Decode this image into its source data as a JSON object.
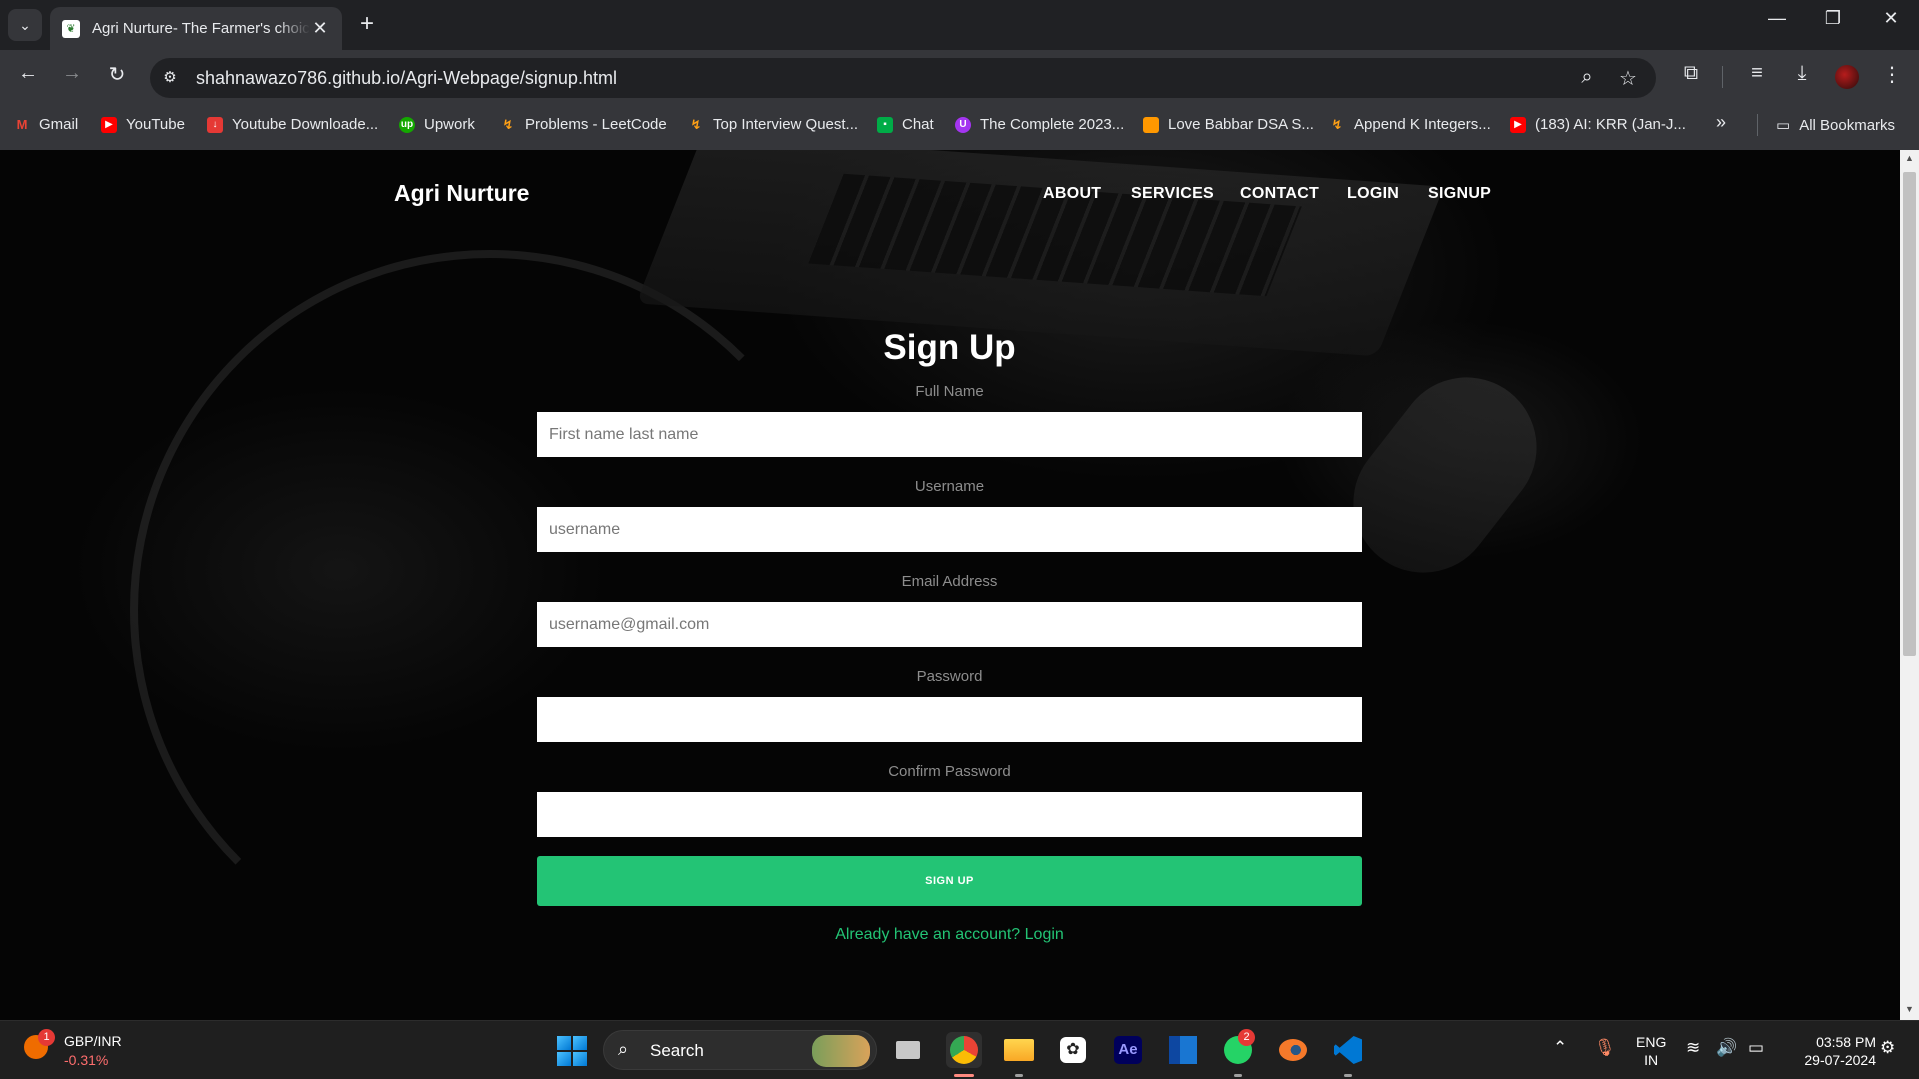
{
  "browser": {
    "tab_title": "Agri Nurture- The Farmer's choice",
    "url": "shahnawazo786.github.io/Agri-Webpage/signup.html",
    "bookmarks": [
      {
        "label": "Gmail",
        "icon": "gmail-icon",
        "color": "#ea4335"
      },
      {
        "label": "YouTube",
        "icon": "youtube-icon",
        "color": "#ff0000"
      },
      {
        "label": "Youtube Downloade...",
        "icon": "download-icon",
        "color": "#e53935"
      },
      {
        "label": "Upwork",
        "icon": "upwork-icon",
        "color": "#14a800"
      },
      {
        "label": "Problems - LeetCode",
        "icon": "leetcode-icon",
        "color": "#ffa116"
      },
      {
        "label": "Top Interview Quest...",
        "icon": "leetcode-icon",
        "color": "#ffa116"
      },
      {
        "label": "Chat",
        "icon": "chat-icon",
        "color": "#00ac47"
      },
      {
        "label": "The Complete 2023...",
        "icon": "course-icon",
        "color": "#a435f0"
      },
      {
        "label": "Love Babbar DSA S...",
        "icon": "sheet-icon",
        "color": "#ff9800"
      },
      {
        "label": "Append K Integers...",
        "icon": "leetcode-icon",
        "color": "#ffa116"
      },
      {
        "label": "(183) AI: KRR (Jan-J...",
        "icon": "youtube-icon",
        "color": "#ff0000"
      }
    ],
    "all_bookmarks": "All Bookmarks"
  },
  "site": {
    "brand": "Agri Nurture",
    "nav": [
      "ABOUT",
      "SERVICES",
      "CONTACT",
      "LOGIN",
      "SIGNUP"
    ]
  },
  "form": {
    "title": "Sign Up",
    "fields": [
      {
        "label": "Full Name",
        "placeholder": "First name last name",
        "value": ""
      },
      {
        "label": "Username",
        "placeholder": "username",
        "value": ""
      },
      {
        "label": "Email Address",
        "placeholder": "username@gmail.com",
        "value": ""
      },
      {
        "label": "Password",
        "placeholder": "",
        "value": ""
      },
      {
        "label": "Confirm Password",
        "placeholder": "",
        "value": ""
      }
    ],
    "submit_label": "SIGN UP",
    "login_link": "Already have an account? Login",
    "accent_color": "#23c475"
  },
  "taskbar": {
    "ticker_name": "GBP/INR",
    "ticker_value": "-0.31%",
    "ticker_badge": "1",
    "search_label": "Search",
    "whatsapp_badge": "2",
    "lang_line1": "ENG",
    "lang_line2": "IN",
    "time": "03:58 PM",
    "date": "29-07-2024"
  }
}
